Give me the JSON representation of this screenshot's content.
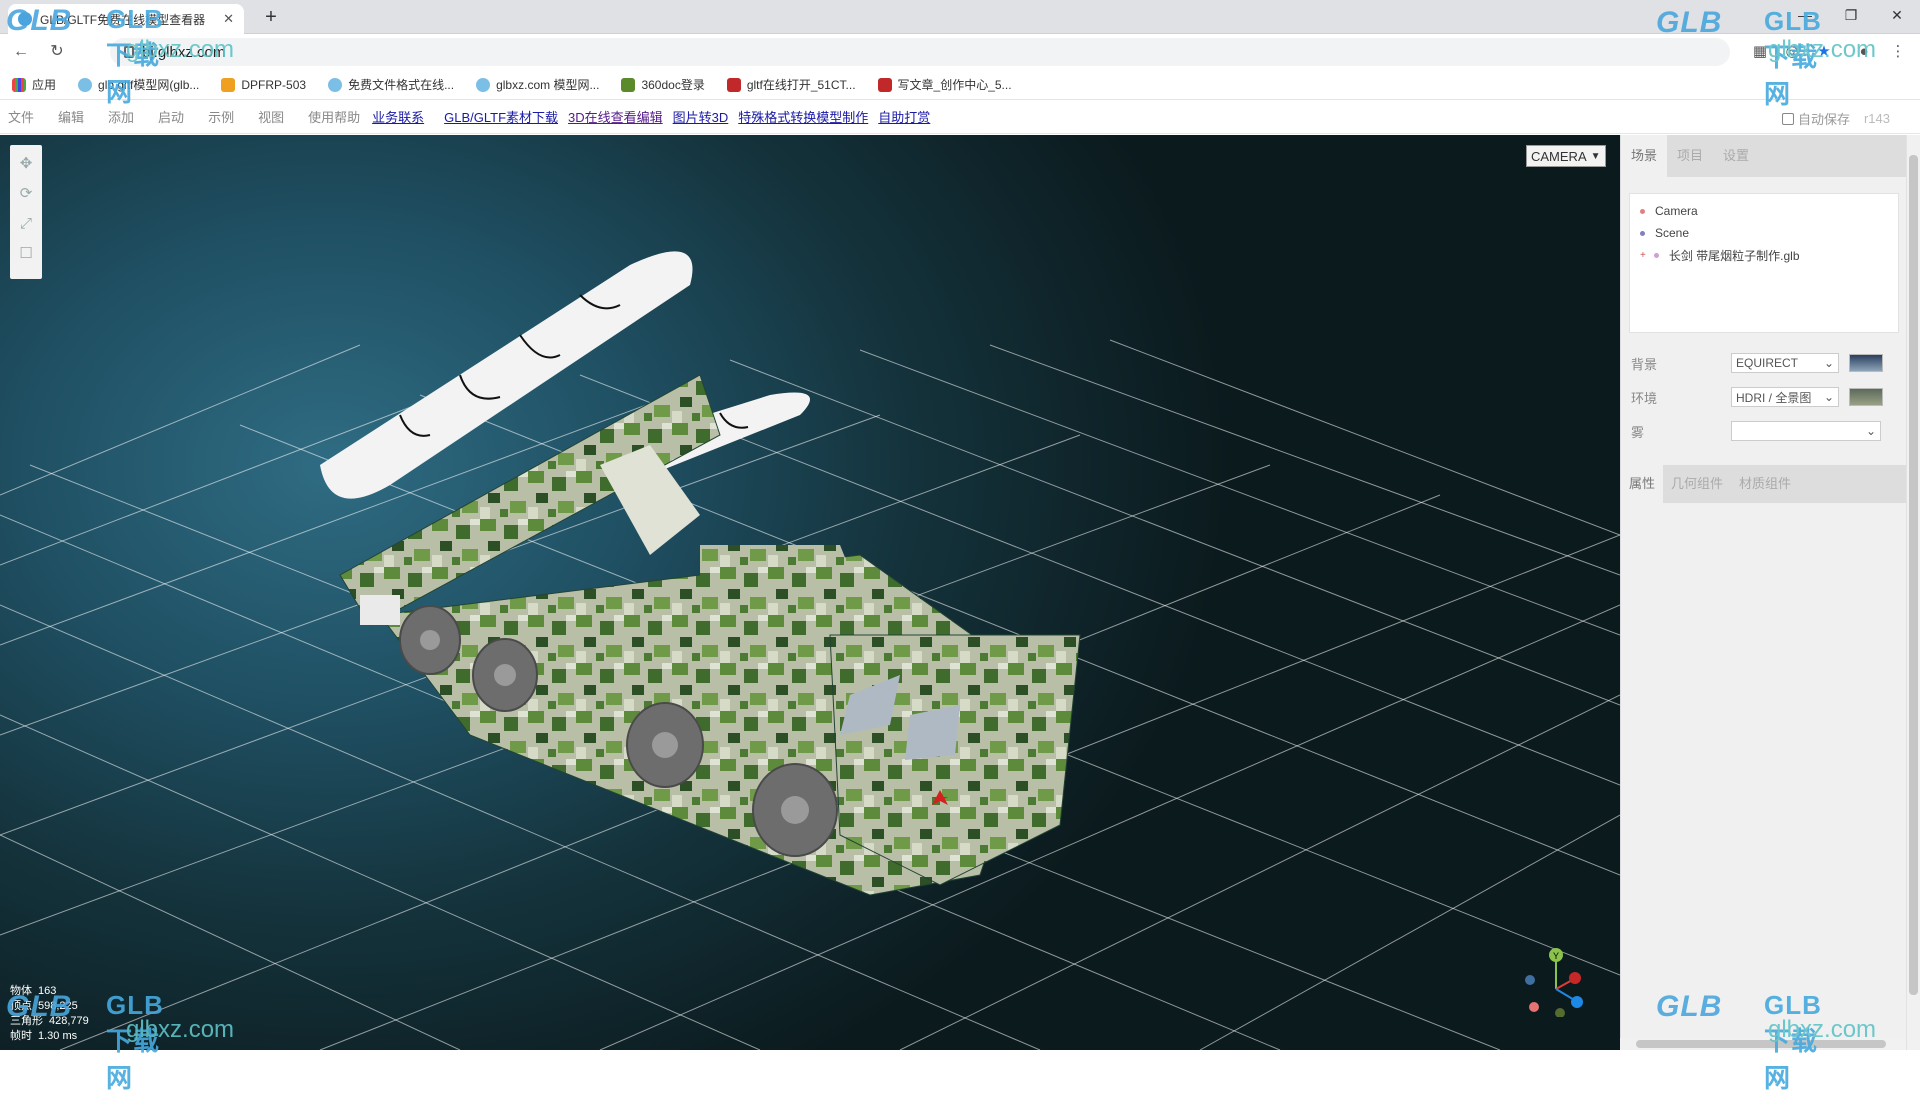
{
  "browser": {
    "tab_title": "GLB/GLTF免费在线模型查看器",
    "url": "bj.glbxz.com",
    "bookmarks": [
      {
        "label": "应用",
        "icon": "apps-grid-icon"
      },
      {
        "label": "glb gltf模型网(glb...",
        "icon": "cloud-icon"
      },
      {
        "label": "DPFRP-503",
        "icon": "box-icon"
      },
      {
        "label": "免费文件格式在线...",
        "icon": "cloud-icon"
      },
      {
        "label": "glbxz.com 模型网...",
        "icon": "cloud-icon"
      },
      {
        "label": "360doc登录",
        "icon": "doc-icon"
      },
      {
        "label": "gltf在线打开_51CT...",
        "icon": "51cto-icon"
      },
      {
        "label": "写文章_创作中心_5...",
        "icon": "51cto-icon"
      }
    ]
  },
  "menubar": {
    "items": [
      "文件",
      "编辑",
      "添加",
      "启动",
      "示例",
      "视图",
      "使用帮助"
    ],
    "links": [
      "业务联系",
      "GLB/GLTF素材下载",
      "3D在线查看编辑",
      "图片转3D",
      "特殊格式转换模型制作",
      "自助打赏"
    ],
    "autosave_label": "自动保存",
    "revision": "r143"
  },
  "viewport": {
    "camera_select": "CAMERA",
    "stats": {
      "objects_label": "物体",
      "objects": "163",
      "vertices_label": "顶点",
      "vertices": "598,225",
      "triangles_label": "三角形",
      "triangles": "428,779",
      "frame_label": "帧时",
      "frame": "1.30 ms"
    },
    "axis_label": "Y"
  },
  "sidebar": {
    "tabs": [
      "场景",
      "项目",
      "设置"
    ],
    "outliner": [
      {
        "label": "Camera",
        "color": "#e08080"
      },
      {
        "label": "Scene",
        "color": "#8080c0"
      },
      {
        "label": "长剑 带尾烟粒子制作.glb",
        "color": "#d0a0d0"
      }
    ],
    "background_label": "背景",
    "background_value": "EQUIRECT",
    "environment_label": "环境",
    "environment_value": "HDRI / 全景图",
    "fog_label": "雾",
    "fog_value": "",
    "prop_tabs": [
      "属性",
      "几何组件",
      "材质组件"
    ]
  },
  "watermark": {
    "logo": "GLB",
    "cn": "GLB下载网",
    "domain": "glbxz.com"
  }
}
